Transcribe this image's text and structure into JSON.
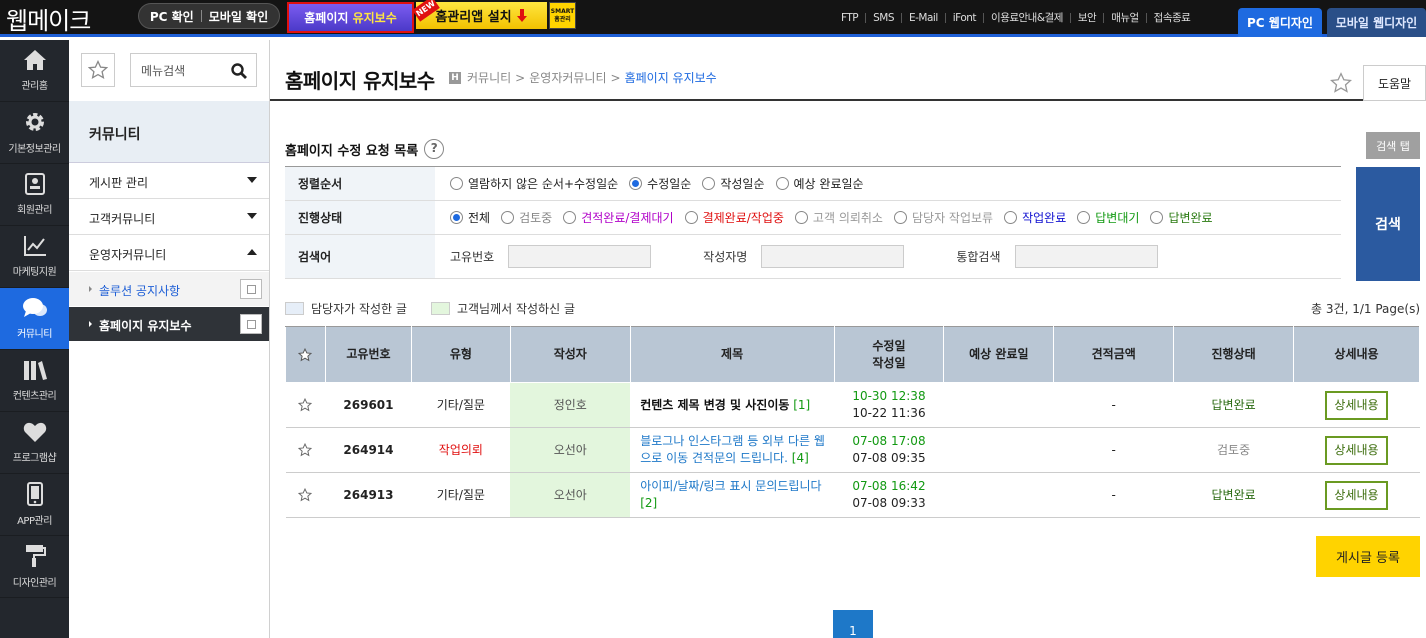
{
  "topbar": {
    "logo": "웹메이크",
    "pc_check": "PC 확인",
    "mobile_check": "모바일 확인",
    "homepage_maint_prefix": "홈페이지 ",
    "homepage_maint_highlight": "유지보수",
    "new_badge": "NEW",
    "app_install": "홈관리앱 설치",
    "smart_badge": "SMART 홈관리",
    "links": [
      "FTP",
      "SMS",
      "E-Mail",
      "iFont",
      "이용료안내&결제",
      "보안",
      "매뉴얼",
      "접속종료"
    ],
    "pc_design": "PC 웹디자인",
    "mobile_design": "모바일 웹디자인"
  },
  "icon_nav": [
    {
      "label": "관리홈",
      "icon": "home-icon"
    },
    {
      "label": "기본정보관리",
      "icon": "gear-icon"
    },
    {
      "label": "회원관리",
      "icon": "member-card-icon"
    },
    {
      "label": "마케팅지원",
      "icon": "line-chart-icon"
    },
    {
      "label": "커뮤니티",
      "icon": "chat-bubble-icon",
      "active": true
    },
    {
      "label": "컨텐츠관리",
      "icon": "books-icon"
    },
    {
      "label": "프로그램샵",
      "icon": "heart-icon"
    },
    {
      "label": "APP관리",
      "icon": "phone-icon"
    },
    {
      "label": "디자인관리",
      "icon": "paint-roller-icon"
    }
  ],
  "sub_nav": {
    "search_placeholder": "메뉴검색",
    "title": "커뮤니티",
    "menus": [
      "게시판 관리",
      "고객커뮤니티",
      "운영자커뮤니티"
    ],
    "sub_items": [
      "솔루션 공지사항",
      "홈페이지 유지보수"
    ]
  },
  "main": {
    "page_title": "홈페이지 유지보수",
    "breadcrumb": [
      "커뮤니티",
      "운영자커뮤니티",
      "홈페이지 유지보수"
    ],
    "breadcrumb_sep": ">",
    "help": "도움말",
    "section_title": "홈페이지 수정 요청 목록",
    "search_tab": "검색 탭",
    "search_button": "검색"
  },
  "search_form": {
    "sort_label": "정렬순서",
    "sort_options": [
      "열람하지 않은 순서+수정일순",
      "수정일순",
      "작성일순",
      "예상 완료일순"
    ],
    "sort_selected": 1,
    "status_label": "진행상태",
    "status_options": [
      {
        "label": "전체",
        "color": "#222222"
      },
      {
        "label": "검토중",
        "color": "#888888"
      },
      {
        "label": "견적완료/결제대기",
        "color": "#b000c8"
      },
      {
        "label": "결제완료/작업중",
        "color": "#e01010"
      },
      {
        "label": "고객 의뢰취소",
        "color": "#999999"
      },
      {
        "label": "담당자 작업보류",
        "color": "#999999"
      },
      {
        "label": "작업완료",
        "color": "#1010d0"
      },
      {
        "label": "답변대기",
        "color": "#119911"
      },
      {
        "label": "답변완료",
        "color": "#2a7a11"
      }
    ],
    "status_selected": 0,
    "keyword_label": "검색어",
    "keyword_fields": [
      "고유번호",
      "작성자명",
      "통합검색"
    ]
  },
  "legend": {
    "staff": "담당자가 작성한 글",
    "staff_color": "#e6eef8",
    "customer": "고객님께서 작성하신 글",
    "customer_color": "#e3f6dd"
  },
  "count_text": "총 3건, 1/1 Page(s)",
  "table": {
    "headers": [
      "고유번호",
      "유형",
      "작성자",
      "제목",
      "수정일",
      "작성일",
      "예상 완료일",
      "견적금액",
      "진행상태",
      "상세내용"
    ],
    "rows": [
      {
        "id": "269601",
        "type": "기타/질문",
        "author": "정인호",
        "title": "컨텐츠 제목 변경 및 사진이동",
        "comments": "[1]",
        "modified": "10-30 12:38",
        "created": "10-22 11:36",
        "expected": "",
        "amount": "-",
        "status": "답변완료",
        "detail": "상세내용"
      },
      {
        "id": "264914",
        "type": "작업의뢰",
        "author": "오선아",
        "title": "블로그나 인스타그램 등 외부 다른 웹으로 이동 견적문의 드립니다.",
        "comments": "[4]",
        "modified": "07-08 17:08",
        "created": "07-08 09:35",
        "expected": "",
        "amount": "-",
        "status": "검토중",
        "detail": "상세내용"
      },
      {
        "id": "264913",
        "type": "기타/질문",
        "author": "오선아",
        "title": "아이피/날짜/링크 표시 문의드립니다",
        "comments": "[2]",
        "modified": "07-08 16:42",
        "created": "07-08 09:33",
        "expected": "",
        "amount": "-",
        "status": "답변완료",
        "detail": "상세내용"
      }
    ]
  },
  "register_button": "게시글 등록",
  "pagination": {
    "current": "1"
  }
}
